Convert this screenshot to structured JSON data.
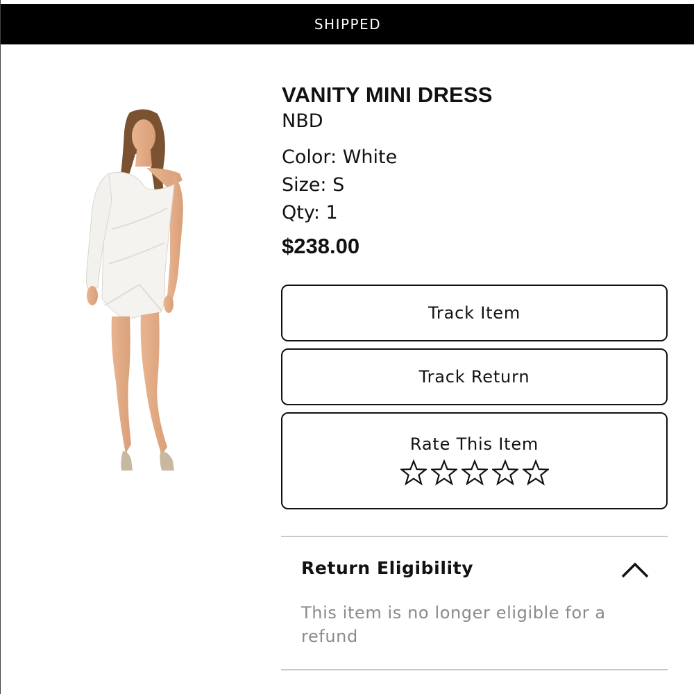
{
  "status": {
    "label": "SHIPPED"
  },
  "product": {
    "name": "VANITY MINI DRESS",
    "brand": "NBD",
    "color": "Color: White",
    "size": "Size: S",
    "qty": "Qty: 1",
    "price": "$238.00",
    "image_icon": "product-photo"
  },
  "actions": {
    "track_item": "Track Item",
    "track_return": "Track Return",
    "rate_label": "Rate This Item",
    "rating": 0,
    "star_count": 5
  },
  "return_eligibility": {
    "title": "Return Eligibility",
    "message": "This item is no longer eligible for a refund",
    "expanded": true,
    "toggle_icon": "chevron-up-icon"
  }
}
